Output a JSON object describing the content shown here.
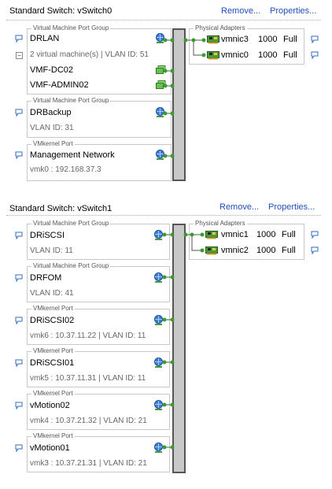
{
  "vswitch0": {
    "title": "Standard Switch: vSwitch0",
    "remove_label": "Remove...",
    "properties_label": "Properties...",
    "port_groups": [
      {
        "type_label": "Virtual Machine Port Group",
        "name": "DRLAN",
        "sub": "2 virtual machine(s) | VLAN ID: 51",
        "vms": [
          "VMF-DC02",
          "VMF-ADMIN02"
        ]
      },
      {
        "type_label": "Virtual Machine Port Group",
        "name": "DRBackup",
        "sub": "VLAN ID: 31"
      },
      {
        "type_label": "VMkernel Port",
        "name": "Management Network",
        "sub": "vmk0 : 192.168.37.3"
      }
    ],
    "physical_adapters_label": "Physical Adapters",
    "adapters": [
      {
        "name": "vmnic3",
        "speed": "1000",
        "duplex": "Full"
      },
      {
        "name": "vmnic0",
        "speed": "1000",
        "duplex": "Full"
      }
    ]
  },
  "vswitch1": {
    "title": "Standard Switch: vSwitch1",
    "remove_label": "Remove...",
    "properties_label": "Properties...",
    "port_groups": [
      {
        "type_label": "Virtual Machine Port Group",
        "name": "DRiSCSI",
        "sub": "VLAN ID: 11"
      },
      {
        "type_label": "Virtual Machine Port Group",
        "name": "DRFOM",
        "sub": "VLAN ID: 41"
      },
      {
        "type_label": "VMkernel Port",
        "name": "DRiSCSI02",
        "sub": "vmk6 : 10.37.11.22 | VLAN ID: 11"
      },
      {
        "type_label": "VMkernel Port",
        "name": "DRiSCSI01",
        "sub": "vmk5 : 10.37.11.31 | VLAN ID: 11"
      },
      {
        "type_label": "VMkernel Port",
        "name": "vMotion02",
        "sub": "vmk4 : 10.37.21.32 | VLAN ID: 21"
      },
      {
        "type_label": "VMkernel Port",
        "name": "vMotion01",
        "sub": "vmk3 : 10.37.21.31 | VLAN ID: 21"
      }
    ],
    "physical_adapters_label": "Physical Adapters",
    "adapters": [
      {
        "name": "vmnic1",
        "speed": "1000",
        "duplex": "Full"
      },
      {
        "name": "vmnic2",
        "speed": "1000",
        "duplex": "Full"
      }
    ]
  },
  "icons": {
    "bubble": "speech-bubble-icon",
    "globe": "network-globe-icon",
    "vm": "virtual-machine-icon",
    "nic": "network-card-icon",
    "collapse": "collapse-minus-icon"
  },
  "colors": {
    "link": "#1f4fbf",
    "connector": "#3a9c2e",
    "bar_fill": "#c8c8c8",
    "bar_border": "#555555"
  }
}
